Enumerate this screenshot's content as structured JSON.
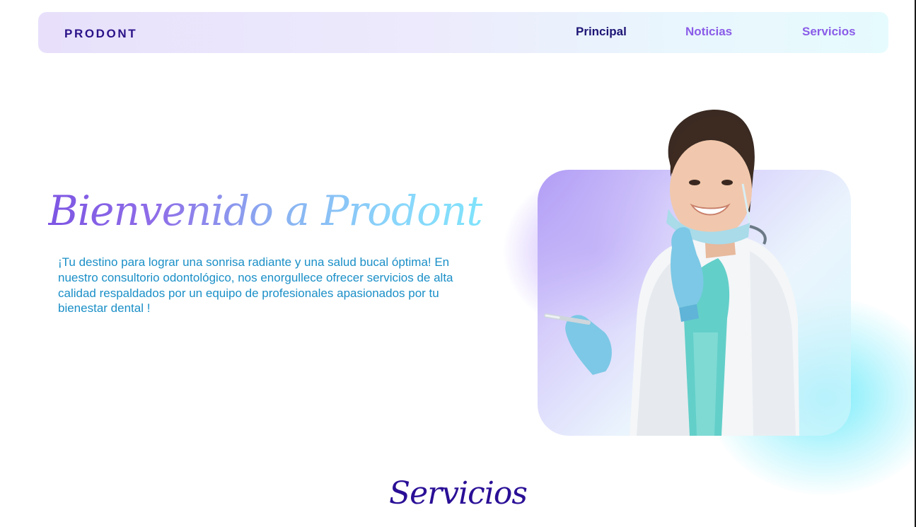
{
  "navbar": {
    "brand": "PRODONT",
    "links": [
      {
        "label": "Principal",
        "active": true
      },
      {
        "label": "Noticias",
        "active": false
      },
      {
        "label": "Servicios",
        "active": false
      }
    ]
  },
  "hero": {
    "title": "Bienvenido a Prodont",
    "description": "¡Tu destino para lograr una sonrisa radiante y una salud bucal óptima! En nuestro consultorio odontológico, nos enorgullece ofrecer servicios de alta calidad respaldados por un equipo de profesionales apasionados por tu bienestar dental !",
    "image_subject": "smiling dentist in white coat, teal scrubs and blue gloves holding a dental tool"
  },
  "services": {
    "title": "Servicios"
  },
  "colors": {
    "brand": "#2a1289",
    "nav_active": "#1e1575",
    "nav_link": "#8a5ce8",
    "body_text": "#1a8fc7",
    "section_title": "#2a0f96",
    "gradient_start": "#7d55e3",
    "gradient_end": "#7fe3fb"
  }
}
